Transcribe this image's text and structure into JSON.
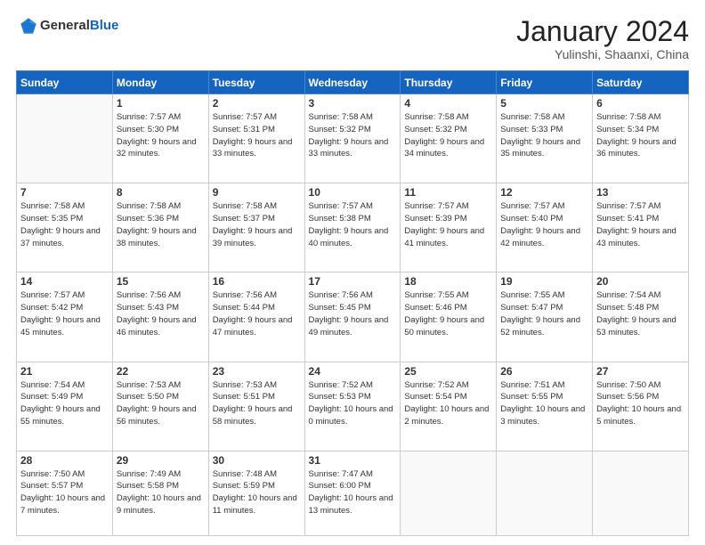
{
  "header": {
    "logo_general": "General",
    "logo_blue": "Blue",
    "month_title": "January 2024",
    "location": "Yulinshi, Shaanxi, China"
  },
  "days_of_week": [
    "Sunday",
    "Monday",
    "Tuesday",
    "Wednesday",
    "Thursday",
    "Friday",
    "Saturday"
  ],
  "weeks": [
    [
      {
        "day": "",
        "info": ""
      },
      {
        "day": "1",
        "info": "Sunrise: 7:57 AM\nSunset: 5:30 PM\nDaylight: 9 hours\nand 32 minutes."
      },
      {
        "day": "2",
        "info": "Sunrise: 7:57 AM\nSunset: 5:31 PM\nDaylight: 9 hours\nand 33 minutes."
      },
      {
        "day": "3",
        "info": "Sunrise: 7:58 AM\nSunset: 5:32 PM\nDaylight: 9 hours\nand 33 minutes."
      },
      {
        "day": "4",
        "info": "Sunrise: 7:58 AM\nSunset: 5:32 PM\nDaylight: 9 hours\nand 34 minutes."
      },
      {
        "day": "5",
        "info": "Sunrise: 7:58 AM\nSunset: 5:33 PM\nDaylight: 9 hours\nand 35 minutes."
      },
      {
        "day": "6",
        "info": "Sunrise: 7:58 AM\nSunset: 5:34 PM\nDaylight: 9 hours\nand 36 minutes."
      }
    ],
    [
      {
        "day": "7",
        "info": "Sunrise: 7:58 AM\nSunset: 5:35 PM\nDaylight: 9 hours\nand 37 minutes."
      },
      {
        "day": "8",
        "info": "Sunrise: 7:58 AM\nSunset: 5:36 PM\nDaylight: 9 hours\nand 38 minutes."
      },
      {
        "day": "9",
        "info": "Sunrise: 7:58 AM\nSunset: 5:37 PM\nDaylight: 9 hours\nand 39 minutes."
      },
      {
        "day": "10",
        "info": "Sunrise: 7:57 AM\nSunset: 5:38 PM\nDaylight: 9 hours\nand 40 minutes."
      },
      {
        "day": "11",
        "info": "Sunrise: 7:57 AM\nSunset: 5:39 PM\nDaylight: 9 hours\nand 41 minutes."
      },
      {
        "day": "12",
        "info": "Sunrise: 7:57 AM\nSunset: 5:40 PM\nDaylight: 9 hours\nand 42 minutes."
      },
      {
        "day": "13",
        "info": "Sunrise: 7:57 AM\nSunset: 5:41 PM\nDaylight: 9 hours\nand 43 minutes."
      }
    ],
    [
      {
        "day": "14",
        "info": "Sunrise: 7:57 AM\nSunset: 5:42 PM\nDaylight: 9 hours\nand 45 minutes."
      },
      {
        "day": "15",
        "info": "Sunrise: 7:56 AM\nSunset: 5:43 PM\nDaylight: 9 hours\nand 46 minutes."
      },
      {
        "day": "16",
        "info": "Sunrise: 7:56 AM\nSunset: 5:44 PM\nDaylight: 9 hours\nand 47 minutes."
      },
      {
        "day": "17",
        "info": "Sunrise: 7:56 AM\nSunset: 5:45 PM\nDaylight: 9 hours\nand 49 minutes."
      },
      {
        "day": "18",
        "info": "Sunrise: 7:55 AM\nSunset: 5:46 PM\nDaylight: 9 hours\nand 50 minutes."
      },
      {
        "day": "19",
        "info": "Sunrise: 7:55 AM\nSunset: 5:47 PM\nDaylight: 9 hours\nand 52 minutes."
      },
      {
        "day": "20",
        "info": "Sunrise: 7:54 AM\nSunset: 5:48 PM\nDaylight: 9 hours\nand 53 minutes."
      }
    ],
    [
      {
        "day": "21",
        "info": "Sunrise: 7:54 AM\nSunset: 5:49 PM\nDaylight: 9 hours\nand 55 minutes."
      },
      {
        "day": "22",
        "info": "Sunrise: 7:53 AM\nSunset: 5:50 PM\nDaylight: 9 hours\nand 56 minutes."
      },
      {
        "day": "23",
        "info": "Sunrise: 7:53 AM\nSunset: 5:51 PM\nDaylight: 9 hours\nand 58 minutes."
      },
      {
        "day": "24",
        "info": "Sunrise: 7:52 AM\nSunset: 5:53 PM\nDaylight: 10 hours\nand 0 minutes."
      },
      {
        "day": "25",
        "info": "Sunrise: 7:52 AM\nSunset: 5:54 PM\nDaylight: 10 hours\nand 2 minutes."
      },
      {
        "day": "26",
        "info": "Sunrise: 7:51 AM\nSunset: 5:55 PM\nDaylight: 10 hours\nand 3 minutes."
      },
      {
        "day": "27",
        "info": "Sunrise: 7:50 AM\nSunset: 5:56 PM\nDaylight: 10 hours\nand 5 minutes."
      }
    ],
    [
      {
        "day": "28",
        "info": "Sunrise: 7:50 AM\nSunset: 5:57 PM\nDaylight: 10 hours\nand 7 minutes."
      },
      {
        "day": "29",
        "info": "Sunrise: 7:49 AM\nSunset: 5:58 PM\nDaylight: 10 hours\nand 9 minutes."
      },
      {
        "day": "30",
        "info": "Sunrise: 7:48 AM\nSunset: 5:59 PM\nDaylight: 10 hours\nand 11 minutes."
      },
      {
        "day": "31",
        "info": "Sunrise: 7:47 AM\nSunset: 6:00 PM\nDaylight: 10 hours\nand 13 minutes."
      },
      {
        "day": "",
        "info": ""
      },
      {
        "day": "",
        "info": ""
      },
      {
        "day": "",
        "info": ""
      }
    ]
  ]
}
